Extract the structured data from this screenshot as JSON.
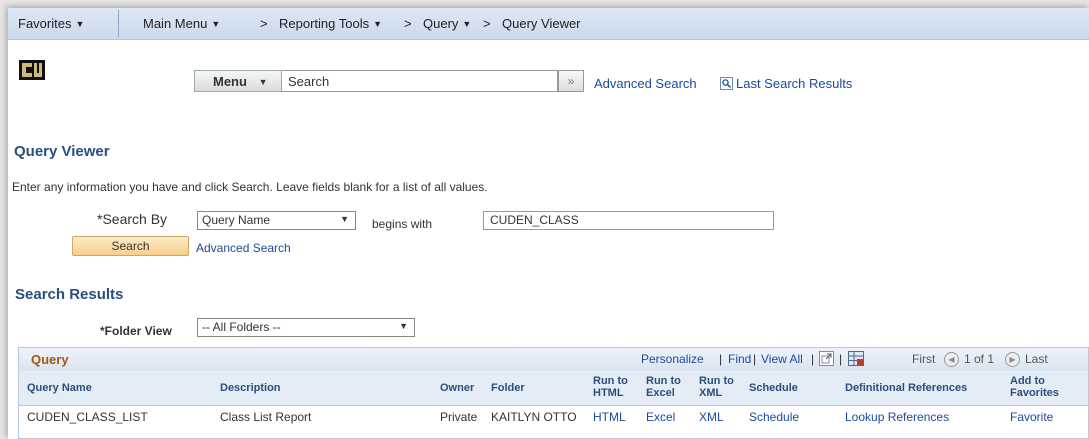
{
  "navbar": {
    "favorites": "Favorites",
    "main_menu": "Main Menu",
    "breadcrumb": [
      "Reporting Tools",
      "Query",
      "Query Viewer"
    ],
    "breadcrumb_sep": ">"
  },
  "header": {
    "menu_label": "Menu",
    "search_value": "Search",
    "go_symbol": "»",
    "advanced_search": "Advanced Search",
    "last_search_results": "Last Search Results"
  },
  "page": {
    "title": "Query Viewer",
    "instructions": "Enter any information you have and click Search. Leave fields blank for a list of all values."
  },
  "search_form": {
    "search_by_label": "*Search By",
    "search_by_value": "Query Name",
    "operator": "begins with",
    "query_value": "CUDEN_CLASS",
    "search_button": "Search",
    "advanced_search": "Advanced Search"
  },
  "results": {
    "section_title": "Search Results",
    "folder_view_label": "*Folder View",
    "folder_view_value": "-- All Folders --",
    "grid": {
      "title": "Query",
      "personalize": "Personalize",
      "find": "Find",
      "view_all": "View All",
      "sep": "|",
      "first": "First",
      "page_count": "1 of 1",
      "last": "Last",
      "columns": {
        "query_name": "Query Name",
        "description": "Description",
        "owner": "Owner",
        "folder": "Folder",
        "run_html": [
          "Run to",
          "HTML"
        ],
        "run_excel": [
          "Run to",
          "Excel"
        ],
        "run_xml": [
          "Run to",
          "XML"
        ],
        "schedule": "Schedule",
        "def_refs": "Definitional References",
        "add_fav": [
          "Add to",
          "Favorites"
        ]
      },
      "rows": [
        {
          "query_name": "CUDEN_CLASS_LIST",
          "description": "Class List Report",
          "owner": "Private",
          "folder": "KAITLYN OTTO",
          "html": "HTML",
          "excel": "Excel",
          "xml": "XML",
          "schedule": "Schedule",
          "refs": "Lookup References",
          "favorite": "Favorite"
        }
      ]
    }
  },
  "colors": {
    "link": "#1a4a9e",
    "heading": "#2b4f7d",
    "grid_title": "#a4570f",
    "nav_bg": "#c9d9ec",
    "logo_gold": "#cfb87c"
  },
  "icons": [
    "chevron-down-icon",
    "magnifier-icon",
    "logo-cu",
    "zoom-icon",
    "download-excel-icon",
    "prev-icon",
    "next-icon"
  ]
}
